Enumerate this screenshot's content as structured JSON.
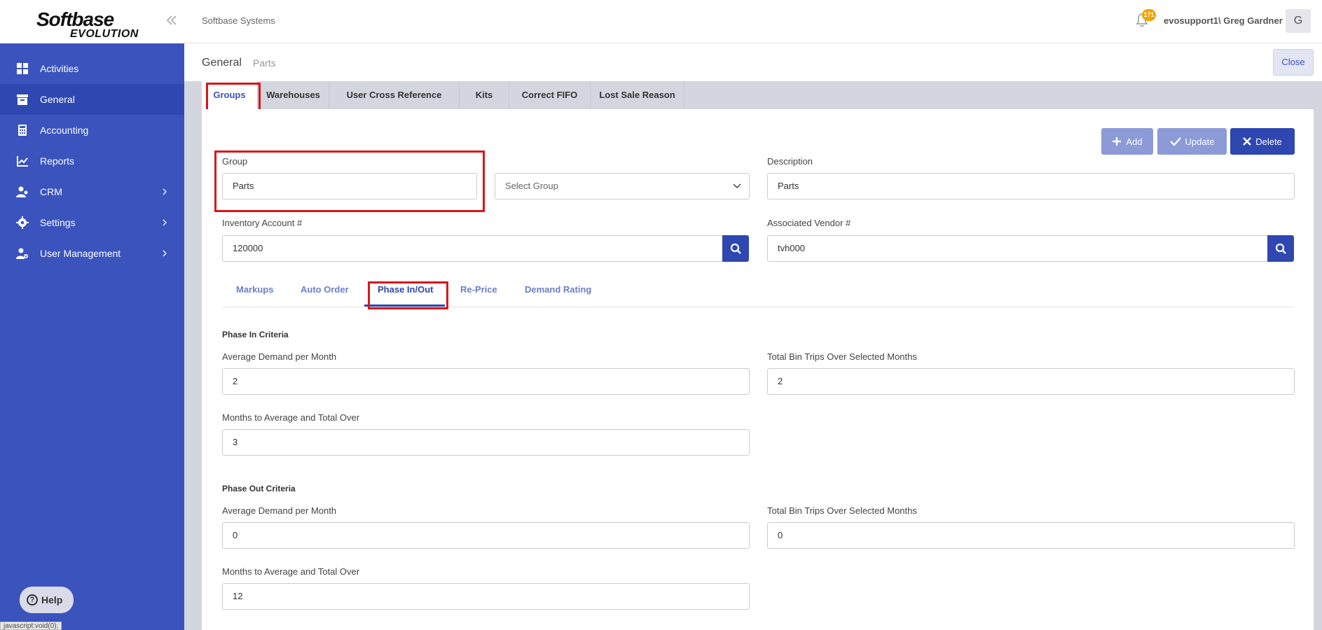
{
  "app": {
    "logo_line1": "Softbase",
    "logo_line2": "EVOLUTION",
    "company": "Softbase Systems",
    "notifications": "171",
    "user": "evosupport1\\ Greg Gardner",
    "avatar_initial": "G",
    "status_url": "javascript:void(0);"
  },
  "sidebar": {
    "items": [
      {
        "label": "Activities",
        "icon": "grid-icon"
      },
      {
        "label": "General",
        "icon": "archive-icon"
      },
      {
        "label": "Accounting",
        "icon": "calculator-icon"
      },
      {
        "label": "Reports",
        "icon": "chart-icon"
      },
      {
        "label": "CRM",
        "icon": "users-icon"
      },
      {
        "label": "Settings",
        "icon": "gear-icon"
      },
      {
        "label": "User Management",
        "icon": "user-gear-icon"
      }
    ],
    "help": "Help"
  },
  "page": {
    "title": "General",
    "subtitle": "Parts",
    "close": "Close"
  },
  "tabs": [
    "Groups",
    "Warehouses",
    "User Cross Reference",
    "Kits",
    "Correct FIFO",
    "Lost Sale Reason"
  ],
  "actions": {
    "add": "Add",
    "update": "Update",
    "delete": "Delete"
  },
  "form": {
    "group_label": "Group",
    "group_value": "Parts",
    "select_group": "Select Group",
    "description_label": "Description",
    "description_value": "Parts",
    "inventory_label": "Inventory Account #",
    "inventory_value": "120000",
    "vendor_label": "Associated Vendor #",
    "vendor_value": "tvh000"
  },
  "subtabs": [
    "Markups",
    "Auto Order",
    "Phase In/Out",
    "Re-Price",
    "Demand Rating"
  ],
  "phase_in": {
    "title": "Phase In Criteria",
    "avg_label": "Average Demand per Month",
    "avg_value": "2",
    "bin_label": "Total Bin Trips Over Selected Months",
    "bin_value": "2",
    "months_label": "Months to Average and Total Over",
    "months_value": "3"
  },
  "phase_out": {
    "title": "Phase Out Criteria",
    "avg_label": "Average Demand per Month",
    "avg_value": "0",
    "bin_label": "Total Bin Trips Over Selected Months",
    "bin_value": "0",
    "months_label": "Months to Average and Total Over",
    "months_value": "12"
  }
}
